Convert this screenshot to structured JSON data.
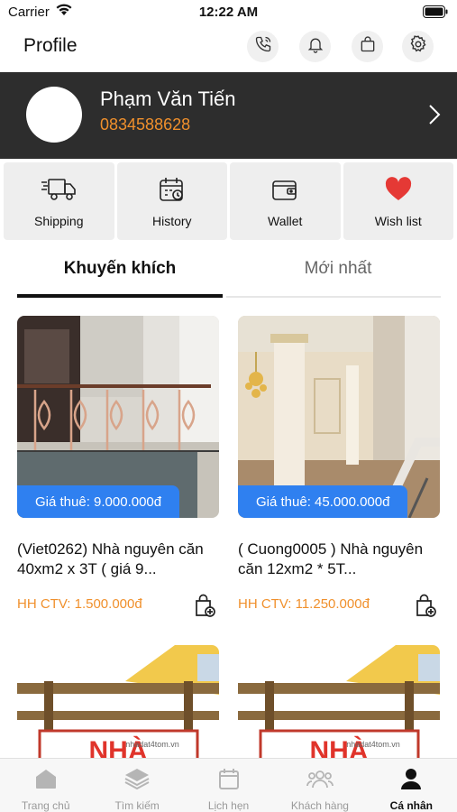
{
  "status_bar": {
    "carrier": "Carrier",
    "time": "12:22 AM"
  },
  "header": {
    "title": "Profile",
    "icons": [
      "phone-call-icon",
      "bell-icon",
      "shopping-bag-icon",
      "gear-icon"
    ]
  },
  "profile": {
    "name": "Phạm Văn Tiến",
    "phone": "0834588628"
  },
  "actions": [
    {
      "label": "Shipping",
      "icon": "delivery-truck-icon"
    },
    {
      "label": "History",
      "icon": "calendar-history-icon"
    },
    {
      "label": "Wallet",
      "icon": "wallet-icon"
    },
    {
      "label": "Wish list",
      "icon": "heart-icon"
    }
  ],
  "tabs": [
    {
      "label": "Khuyến khích",
      "active": true
    },
    {
      "label": "Mới nhất",
      "active": false
    }
  ],
  "products": [
    {
      "price": "Giá thuê: 9.000.000đ",
      "name": "(Viet0262) Nhà nguyên căn 40xm2 x 3T  ( giá 9...",
      "commission": "HH CTV: 1.500.000đ"
    },
    {
      "price": "Giá thuê: 45.000.000đ",
      "name": "( Cuong0005 ) Nhà nguyên căn 12xm2 * 5T...",
      "commission": "HH CTV: 11.250.000đ"
    }
  ],
  "placeholder_sign": {
    "text": "NHÀ",
    "domain": "nhadat4tom.vn"
  },
  "bottom_nav": [
    {
      "label": "Trang chủ",
      "icon": "home-icon",
      "active": false
    },
    {
      "label": "Tìm kiếm",
      "icon": "layers-icon",
      "active": false
    },
    {
      "label": "Lịch hẹn",
      "icon": "calendar-icon",
      "active": false
    },
    {
      "label": "Khách hàng",
      "icon": "customers-icon",
      "active": false
    },
    {
      "label": "Cá nhân",
      "icon": "user-icon",
      "active": true
    }
  ],
  "colors": {
    "accent_orange": "#f0902c",
    "price_blue": "#2f80f0",
    "banner_dark": "#2d2d2d",
    "heart_red": "#e53935"
  }
}
